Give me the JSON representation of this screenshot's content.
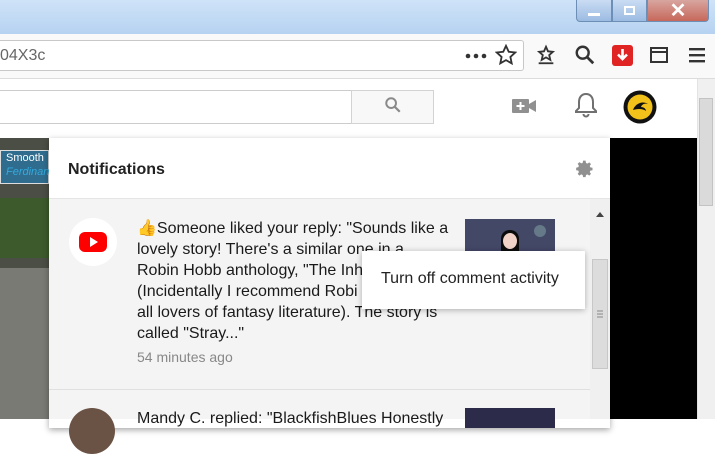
{
  "window": {
    "minimize_icon": "minimize-icon",
    "maximize_icon": "restore-icon",
    "close_icon": "close-icon",
    "close_glyph": "✕"
  },
  "browser": {
    "url_text": "04X3c",
    "toolbar_icons": [
      "more-dots-icon",
      "bookmark-star-icon",
      "reading-list-icon",
      "search-icon",
      "download-extension-icon",
      "window-icon",
      "menu-icon"
    ]
  },
  "youtube": {
    "header_icons": [
      "create-video-icon",
      "notifications-bell-icon",
      "user-avatar"
    ],
    "search_button_icon": "search-icon",
    "video_overlay": {
      "line1": "Smooth",
      "line2": "Ferdinan"
    }
  },
  "notifications": {
    "title": "Notifications",
    "items": [
      {
        "emoji": "👍",
        "lines": [
          "Someone liked your reply: \"Sounds like a",
          "lovely story! There's a similar one in a",
          "Robin Hobb anthology, \"The Inh",
          "(Incidentally I recommend Robi",
          "all lovers of fantasy literature). The story is",
          "called \"Stray...\""
        ],
        "time": "54 minutes ago"
      },
      {
        "lines": [
          "Mandy C. replied: \"BlackfishBlues Honestly"
        ]
      }
    ]
  },
  "context_menu": {
    "item": "Turn off comment activity"
  },
  "colors": {
    "youtube_red": "#ff0000",
    "titlebar": "#b6d2f1",
    "close_button": "#c7685b",
    "download_ext_red": "#e02424"
  }
}
